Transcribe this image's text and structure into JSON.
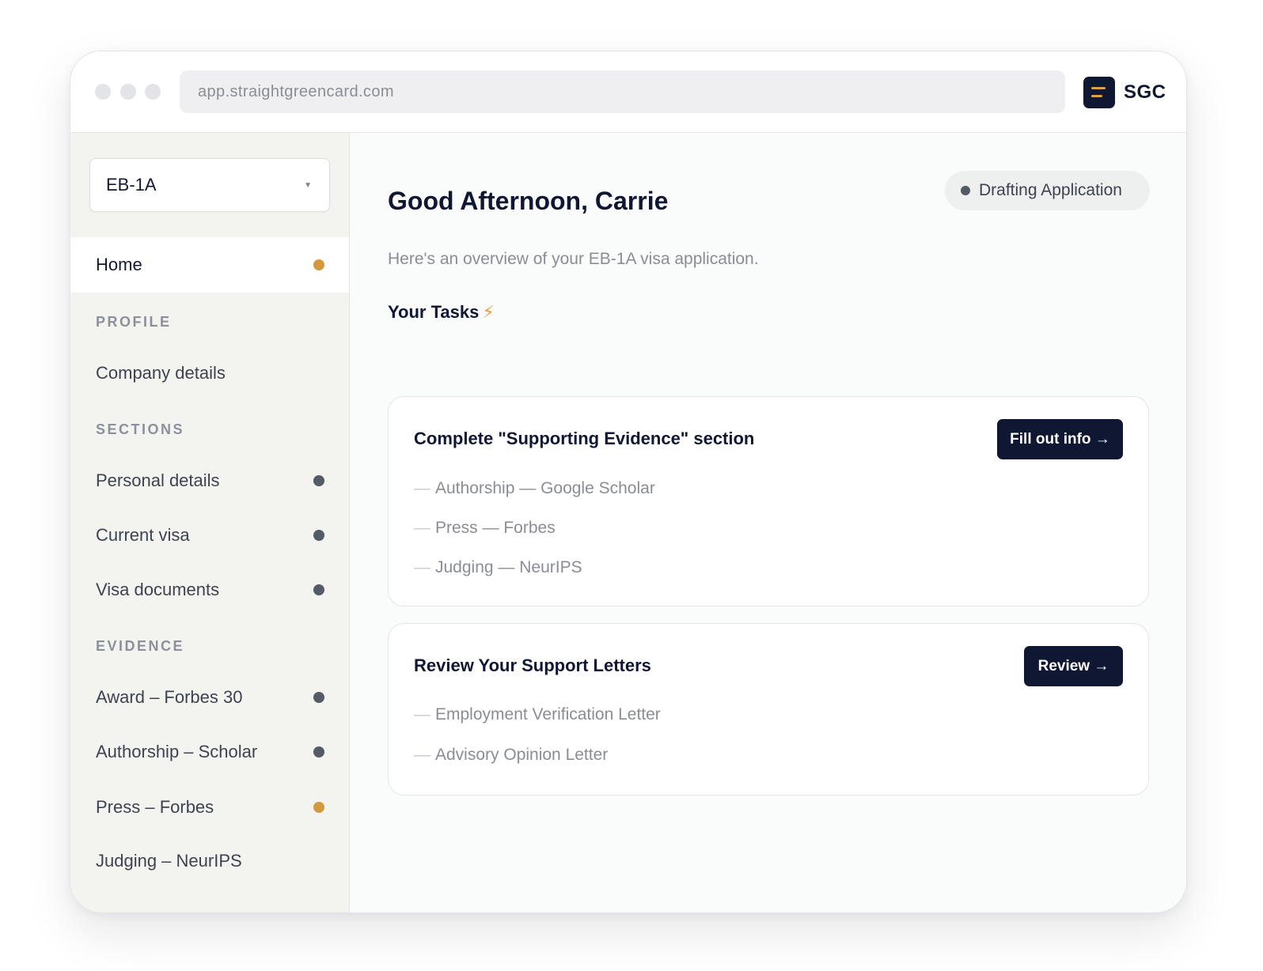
{
  "browser": {
    "url": "app.straightgreencard.com",
    "brand": "SGC",
    "brand_accent": "#e0a04a"
  },
  "sidebar": {
    "visa_select": {
      "value": "EB-1A"
    },
    "home": {
      "label": "Home",
      "status": "pending"
    },
    "sections": [
      {
        "title": "PROFILE",
        "items": [
          {
            "label": "Company details",
            "status": "none"
          }
        ]
      },
      {
        "title": "SECTIONS",
        "items": [
          {
            "label": "Personal details",
            "status": "done"
          },
          {
            "label": "Current visa",
            "status": "done"
          },
          {
            "label": "Visa documents",
            "status": "done"
          }
        ]
      },
      {
        "title": "EVIDENCE",
        "items": [
          {
            "label": "Award – Forbes 30",
            "status": "done"
          },
          {
            "label": "Authorship – Scholar",
            "status": "done"
          },
          {
            "label": "Press – Forbes",
            "status": "pending"
          },
          {
            "label": "Judging – NeurIPS",
            "status": "none"
          }
        ]
      }
    ]
  },
  "status_colors": {
    "pending": "#d4993f",
    "done": "#555b66"
  },
  "main": {
    "greeting": "Good Afternoon, Carrie",
    "status_pill": "Drafting Application",
    "subtitle": "Here's an overview of your EB-1A visa application.",
    "tasks_heading": "Your Tasks",
    "tasks_icon": "lightning-bolt-icon",
    "tasks": [
      {
        "title": "Complete \"Supporting Evidence\" section",
        "button": "Fill out info →",
        "items": [
          "Authorship — Google Scholar",
          "Press — Forbes",
          "Judging — NeurIPS"
        ]
      },
      {
        "title": "Review Your Support Letters",
        "button": "Review →",
        "items": [
          "Employment Verification Letter",
          "Advisory Opinion Letter"
        ]
      }
    ]
  }
}
